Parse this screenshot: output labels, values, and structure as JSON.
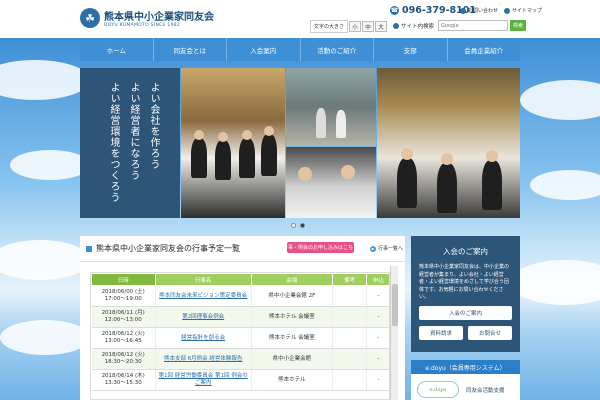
{
  "header": {
    "logo_mark": "☘",
    "title": "熊本県中小企業家同友会",
    "subtitle": "DOYU KUMAMOTO SINCE 1982",
    "tel": "096-379-8101",
    "links": [
      "お問い合わせ",
      "サイトマップ"
    ],
    "font_size_label": "文字の大きさ",
    "font_sizes": [
      "小",
      "中",
      "大"
    ],
    "search_label": "サイト内検索",
    "search_placeholder": "Google",
    "search_button": "検索"
  },
  "nav": {
    "items": [
      "ホーム",
      "同友会とは",
      "入会案内",
      "活動のご紹介",
      "支部",
      "会員企業紹介"
    ]
  },
  "hero": {
    "slogan_lines": [
      "よい会社を作ろう",
      "よい経営者になろう",
      "よい経営環境をつくろう"
    ],
    "slides": 2,
    "active_slide": 2
  },
  "schedule": {
    "title": "熊本県中小企業家同友会の行事予定一覧",
    "pink_button": "行事・例会のお申し込みはこちら",
    "list_link": "行事一覧へ",
    "columns": [
      "日時",
      "行事名",
      "会場",
      "備考",
      "申込"
    ],
    "rows": [
      {
        "date": "2018/06/00 (土)\n17:00〜19:00",
        "event": "熊本同友会未来ビジョン策定委員会",
        "venue": "県中小企業会館 2F",
        "note": "",
        "apply": "-"
      },
      {
        "date": "2018/06/11 (月)\n12:00〜13:00",
        "event": "第2回理事会例会",
        "venue": "熊本ホテル 会議室",
        "note": "",
        "apply": "-"
      },
      {
        "date": "2018/06/12 (火)\n13:00〜16:45",
        "event": "経営指針を創る会",
        "venue": "熊本ホテル 会議室",
        "note": "",
        "apply": "-"
      },
      {
        "date": "2018/06/12 (火)\n18:30〜20:30",
        "event": "熊本支部 6月例会 経営体験報告",
        "venue": "県中小企業会館",
        "note": "",
        "apply": "-"
      },
      {
        "date": "2018/06/14 (木)\n13:30〜15:30",
        "event": "第1回 経営労働委員会 第1回 例会のご案内",
        "venue": "熊本ホテル",
        "note": "",
        "apply": "-"
      }
    ]
  },
  "side": {
    "title": "入会のご案内",
    "text": "熊本県中小企業家同友会は、中小企業の経営者が集まり、よい会社・よい経営者・よい経営環境をめざして学び合う団体です。お気軽にお問い合わせください。",
    "buttons": [
      "入会のご案内",
      "資料請求",
      "お問合せ"
    ]
  },
  "edoyu": {
    "bar": "e.doyu（会員専用システム）",
    "logo": "e.doyu",
    "label": "同友会活動支援"
  }
}
